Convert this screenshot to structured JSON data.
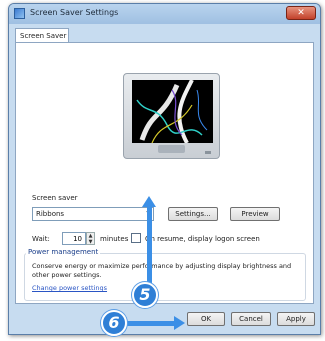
{
  "window": {
    "title": "Screen Saver Settings",
    "close_label": "✕"
  },
  "tabs": [
    {
      "label": "Screen Saver"
    }
  ],
  "preview": {
    "screensaver_preview": "ribbons animation"
  },
  "screen_saver": {
    "section_label": "Screen saver",
    "selected": "Ribbons",
    "settings_button": "Settings...",
    "preview_button": "Preview"
  },
  "wait": {
    "label": "Wait:",
    "value": "10",
    "units": "minutes",
    "resume_label": "On resume, display logon screen"
  },
  "power": {
    "title": "Power management",
    "description": "Conserve energy or maximize performance by adjusting display brightness and other power settings.",
    "link": "Change power settings"
  },
  "footer": {
    "ok": "OK",
    "cancel": "Cancel",
    "apply": "Apply"
  },
  "callouts": {
    "step5": "5",
    "step6": "6"
  },
  "colors": {
    "callout": "#2f7fd6",
    "window_frame": "#c7dcf0"
  }
}
